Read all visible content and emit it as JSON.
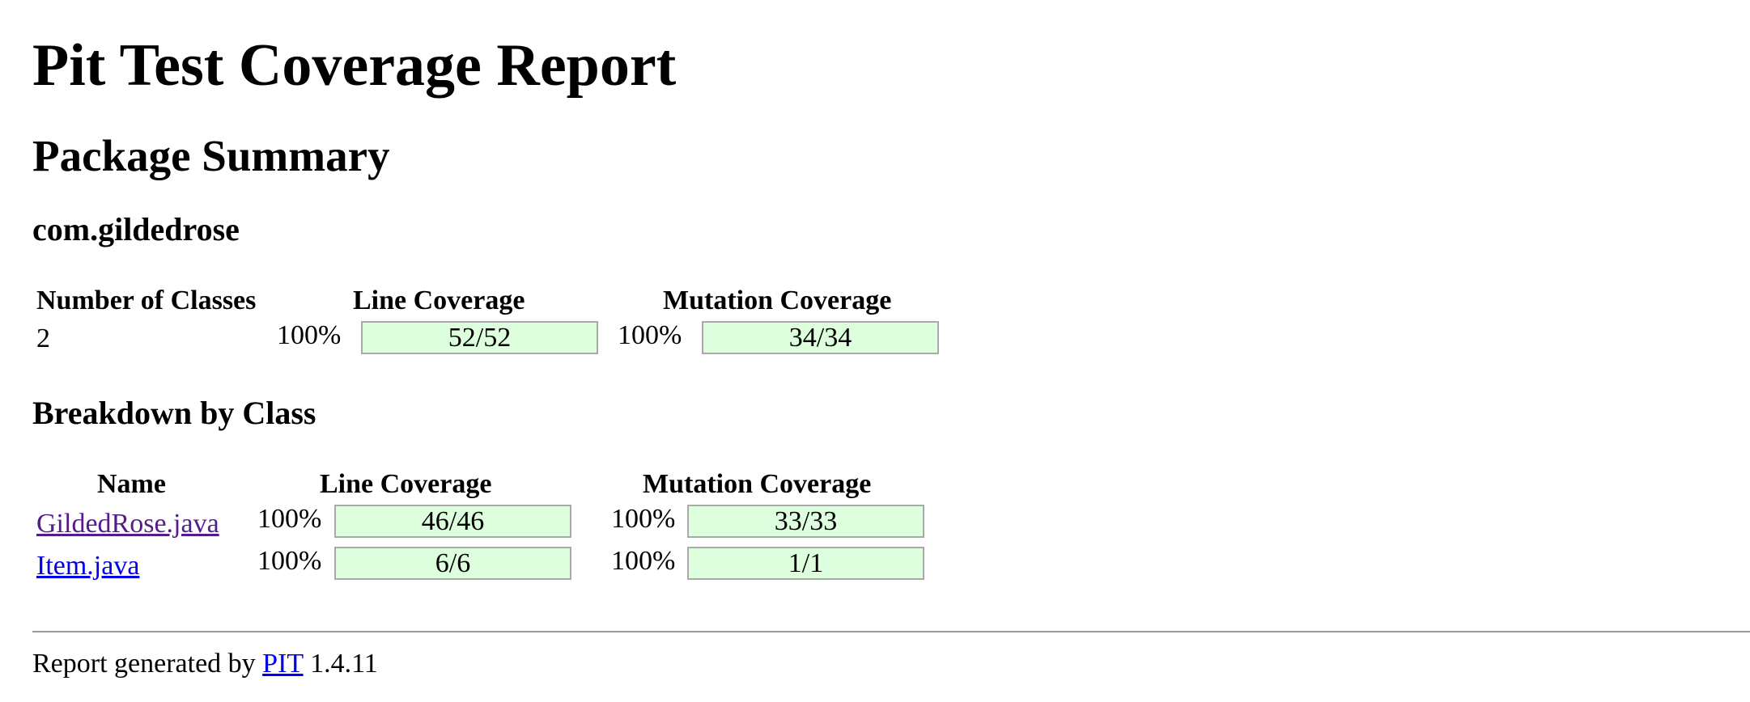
{
  "page": {
    "title": "Pit Test Coverage Report",
    "section_title": "Package Summary",
    "package_name": "com.gildedrose",
    "breakdown_title": "Breakdown by Class"
  },
  "summary": {
    "headers": {
      "classes": "Number of Classes",
      "line": "Line Coverage",
      "mutation": "Mutation Coverage"
    },
    "row": {
      "classes": "2",
      "line_percent": "100%",
      "line_ratio": "52/52",
      "line_fill": 1.0,
      "mutation_percent": "100%",
      "mutation_ratio": "34/34",
      "mutation_fill": 1.0
    }
  },
  "breakdown": {
    "headers": {
      "name": "Name",
      "line": "Line Coverage",
      "mutation": "Mutation Coverage"
    },
    "rows": [
      {
        "name": "GildedRose.java",
        "line_percent": "100%",
        "line_ratio": "46/46",
        "line_fill": 1.0,
        "mutation_percent": "100%",
        "mutation_ratio": "33/33",
        "mutation_fill": 1.0
      },
      {
        "name": "Item.java",
        "line_percent": "100%",
        "line_ratio": "6/6",
        "line_fill": 1.0,
        "mutation_percent": "100%",
        "mutation_ratio": "1/1",
        "mutation_fill": 1.0
      }
    ]
  },
  "footer": {
    "prefix": "Report generated by",
    "link_text": "PIT",
    "version": "1.4.11"
  },
  "colors": {
    "bar_fill": "#ddffdd",
    "bar_border": "#a9a9a9",
    "link": "#0000ee",
    "visited_link": "#551a8b"
  }
}
